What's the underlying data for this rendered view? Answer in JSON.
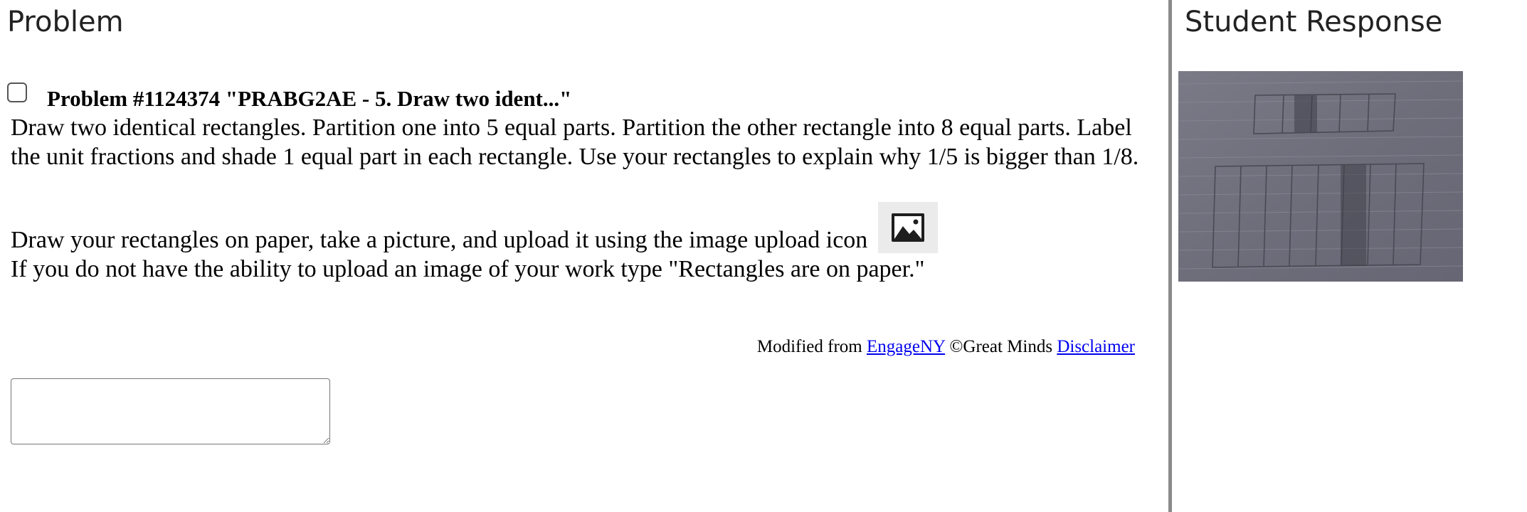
{
  "problem_panel": {
    "heading": "Problem",
    "problem_title": "Problem #1124374 \"PRABG2AE - 5. Draw two ident...\"",
    "body_text": "Draw two identical rectangles. Partition one into 5 equal parts. Partition the other rectangle into 8 equal parts. Label the unit fractions and shade 1 equal part in each rectangle. Use your rectangles to explain why 1/5 is bigger than 1/8.",
    "instruction_upload": "Draw your rectangles on paper, take a picture, and upload it using the image upload icon",
    "instruction_alternative": "If you do not have the ability to upload an image of your work type \"Rectangles are on paper.\"",
    "upload_icon": "image-icon",
    "attribution": {
      "prefix": "Modified from",
      "link_engageny": "EngageNY",
      "copyright": "©Great Minds",
      "link_disclaimer": "Disclaimer"
    },
    "answer_value": ""
  },
  "response_panel": {
    "heading": "Student Response",
    "image_content": "photo-of-hand-drawn-rectangles"
  },
  "colors": {
    "link": "#0000ee",
    "divider": "#8a8a8a",
    "heading_text": "#222222",
    "photo_background": "#6f6f7c"
  }
}
